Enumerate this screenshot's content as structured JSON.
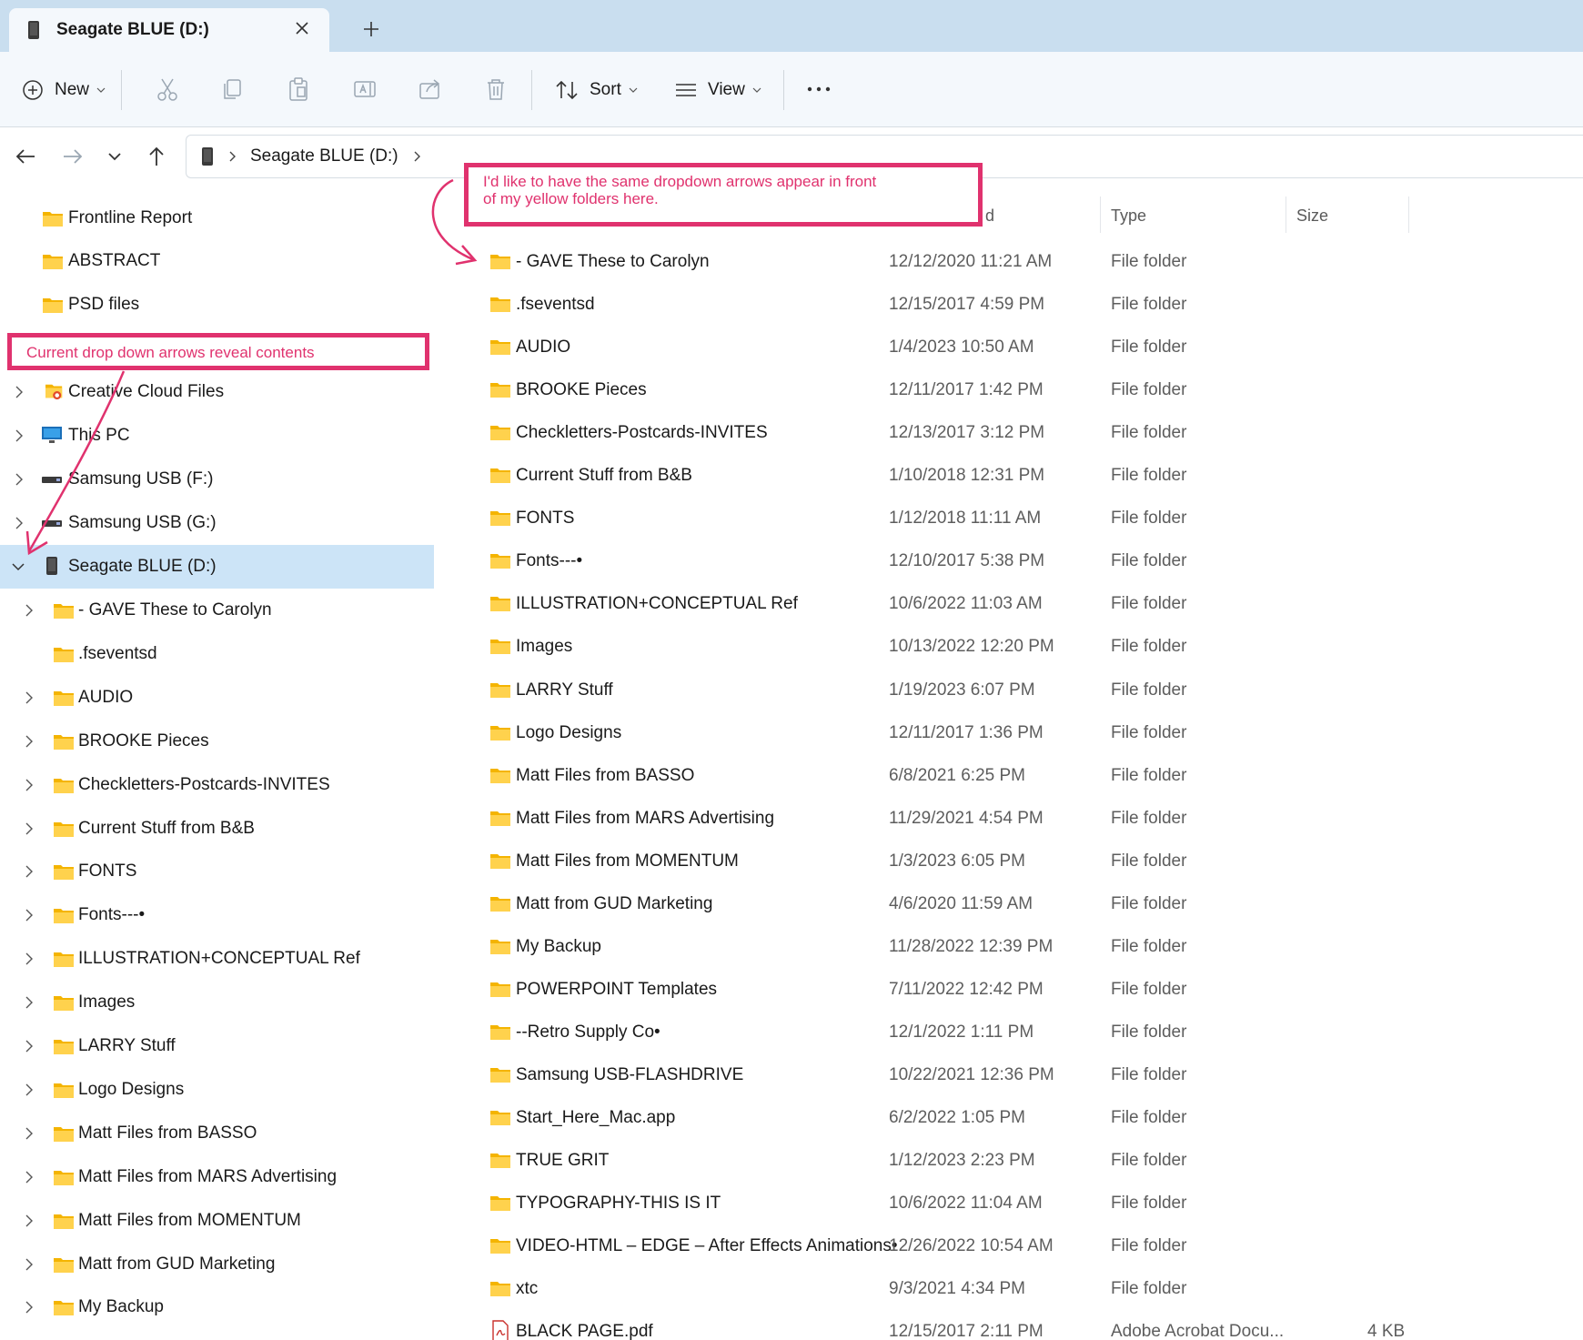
{
  "window": {
    "tab_title": "Seagate BLUE (D:)",
    "tab_close_icon": "close-icon",
    "new_tab_icon": "plus-icon"
  },
  "toolbar": {
    "new_label": "New",
    "sort_label": "Sort",
    "view_label": "View",
    "icons": [
      "cut-icon",
      "copy-icon",
      "paste-icon",
      "rename-icon",
      "share-icon",
      "delete-icon",
      "more-icon"
    ]
  },
  "address": {
    "crumbs": [
      "Seagate BLUE (D:)"
    ]
  },
  "annotations": {
    "top_note": "I'd like to have the same dropdown arrows appear in front",
    "top_note_line2": "of my yellow folders here.",
    "left_note": "Current drop down arrows reveal contents",
    "color": "#e0326e"
  },
  "columns": {
    "date": "d",
    "type": "Type",
    "size": "Size"
  },
  "navpane": {
    "pinned": [
      {
        "label": "Frontline Report"
      },
      {
        "label": "ABSTRACT"
      },
      {
        "label": "PSD files"
      }
    ],
    "roots": [
      {
        "label": "Creative Cloud Files",
        "icon": "creative-cloud-folder-icon"
      },
      {
        "label": "This PC",
        "icon": "monitor-icon"
      },
      {
        "label": "Samsung USB (F:)",
        "icon": "usb-drive-icon"
      },
      {
        "label": "Samsung USB (G:)",
        "icon": "usb-drive-icon"
      },
      {
        "label": "Seagate BLUE (D:)",
        "icon": "external-drive-icon",
        "selected": true
      }
    ],
    "children": [
      {
        "label": "- GAVE These to Carolyn",
        "expandable": true
      },
      {
        "label": ".fseventsd",
        "expandable": false
      },
      {
        "label": "AUDIO",
        "expandable": true
      },
      {
        "label": "BROOKE Pieces",
        "expandable": true
      },
      {
        "label": "Checkletters-Postcards-INVITES",
        "expandable": true
      },
      {
        "label": "Current Stuff from B&B",
        "expandable": true
      },
      {
        "label": "FONTS",
        "expandable": true
      },
      {
        "label": "Fonts---•",
        "expandable": true
      },
      {
        "label": "ILLUSTRATION+CONCEPTUAL Ref",
        "expandable": true
      },
      {
        "label": "Images",
        "expandable": true
      },
      {
        "label": "LARRY Stuff",
        "expandable": true
      },
      {
        "label": "Logo Designs",
        "expandable": true
      },
      {
        "label": "Matt Files from BASSO",
        "expandable": true
      },
      {
        "label": "Matt Files from MARS Advertising",
        "expandable": true
      },
      {
        "label": "Matt Files from MOMENTUM",
        "expandable": true
      },
      {
        "label": "Matt from GUD Marketing",
        "expandable": true
      },
      {
        "label": "My Backup",
        "expandable": true
      }
    ]
  },
  "files": [
    {
      "name": "- GAVE These to Carolyn",
      "date": "12/12/2020 11:21 AM",
      "type": "File folder",
      "size": ""
    },
    {
      "name": ".fseventsd",
      "date": "12/15/2017 4:59 PM",
      "type": "File folder",
      "size": ""
    },
    {
      "name": "AUDIO",
      "date": "1/4/2023 10:50 AM",
      "type": "File folder",
      "size": ""
    },
    {
      "name": "BROOKE Pieces",
      "date": "12/11/2017 1:42 PM",
      "type": "File folder",
      "size": ""
    },
    {
      "name": "Checkletters-Postcards-INVITES",
      "date": "12/13/2017 3:12 PM",
      "type": "File folder",
      "size": ""
    },
    {
      "name": "Current Stuff from B&B",
      "date": "1/10/2018 12:31 PM",
      "type": "File folder",
      "size": ""
    },
    {
      "name": "FONTS",
      "date": "1/12/2018 11:11 AM",
      "type": "File folder",
      "size": ""
    },
    {
      "name": "Fonts---•",
      "date": "12/10/2017 5:38 PM",
      "type": "File folder",
      "size": ""
    },
    {
      "name": "ILLUSTRATION+CONCEPTUAL Ref",
      "date": "10/6/2022 11:03 AM",
      "type": "File folder",
      "size": ""
    },
    {
      "name": "Images",
      "date": "10/13/2022 12:20 PM",
      "type": "File folder",
      "size": ""
    },
    {
      "name": "LARRY Stuff",
      "date": "1/19/2023 6:07 PM",
      "type": "File folder",
      "size": ""
    },
    {
      "name": "Logo Designs",
      "date": "12/11/2017 1:36 PM",
      "type": "File folder",
      "size": ""
    },
    {
      "name": "Matt Files from BASSO",
      "date": "6/8/2021 6:25 PM",
      "type": "File folder",
      "size": ""
    },
    {
      "name": "Matt Files from MARS Advertising",
      "date": "11/29/2021 4:54 PM",
      "type": "File folder",
      "size": ""
    },
    {
      "name": "Matt Files from MOMENTUM",
      "date": "1/3/2023 6:05 PM",
      "type": "File folder",
      "size": ""
    },
    {
      "name": "Matt from GUD Marketing",
      "date": "4/6/2020 11:59 AM",
      "type": "File folder",
      "size": ""
    },
    {
      "name": "My Backup",
      "date": "11/28/2022 12:39 PM",
      "type": "File folder",
      "size": ""
    },
    {
      "name": "POWERPOINT Templates",
      "date": "7/11/2022 12:42 PM",
      "type": "File folder",
      "size": ""
    },
    {
      "name": "--Retro Supply Co•",
      "date": "12/1/2022 1:11 PM",
      "type": "File folder",
      "size": ""
    },
    {
      "name": "Samsung USB-FLASHDRIVE",
      "date": "10/22/2021 12:36 PM",
      "type": "File folder",
      "size": ""
    },
    {
      "name": "Start_Here_Mac.app",
      "date": "6/2/2022 1:05 PM",
      "type": "File folder",
      "size": ""
    },
    {
      "name": "TRUE GRIT",
      "date": "1/12/2023 2:23 PM",
      "type": "File folder",
      "size": ""
    },
    {
      "name": "TYPOGRAPHY-THIS IS IT",
      "date": "10/6/2022 11:04 AM",
      "type": "File folder",
      "size": ""
    },
    {
      "name": "VIDEO-HTML – EDGE – After Effects Animations•",
      "date": "12/26/2022 10:54 AM",
      "type": "File folder",
      "size": ""
    },
    {
      "name": "xtc",
      "date": "9/3/2021 4:34 PM",
      "type": "File folder",
      "size": ""
    },
    {
      "name": "BLACK PAGE.pdf",
      "date": "12/15/2017 2:11 PM",
      "type": "Adobe Acrobat Docu...",
      "size": "4 KB",
      "icon": "pdf-icon"
    }
  ]
}
